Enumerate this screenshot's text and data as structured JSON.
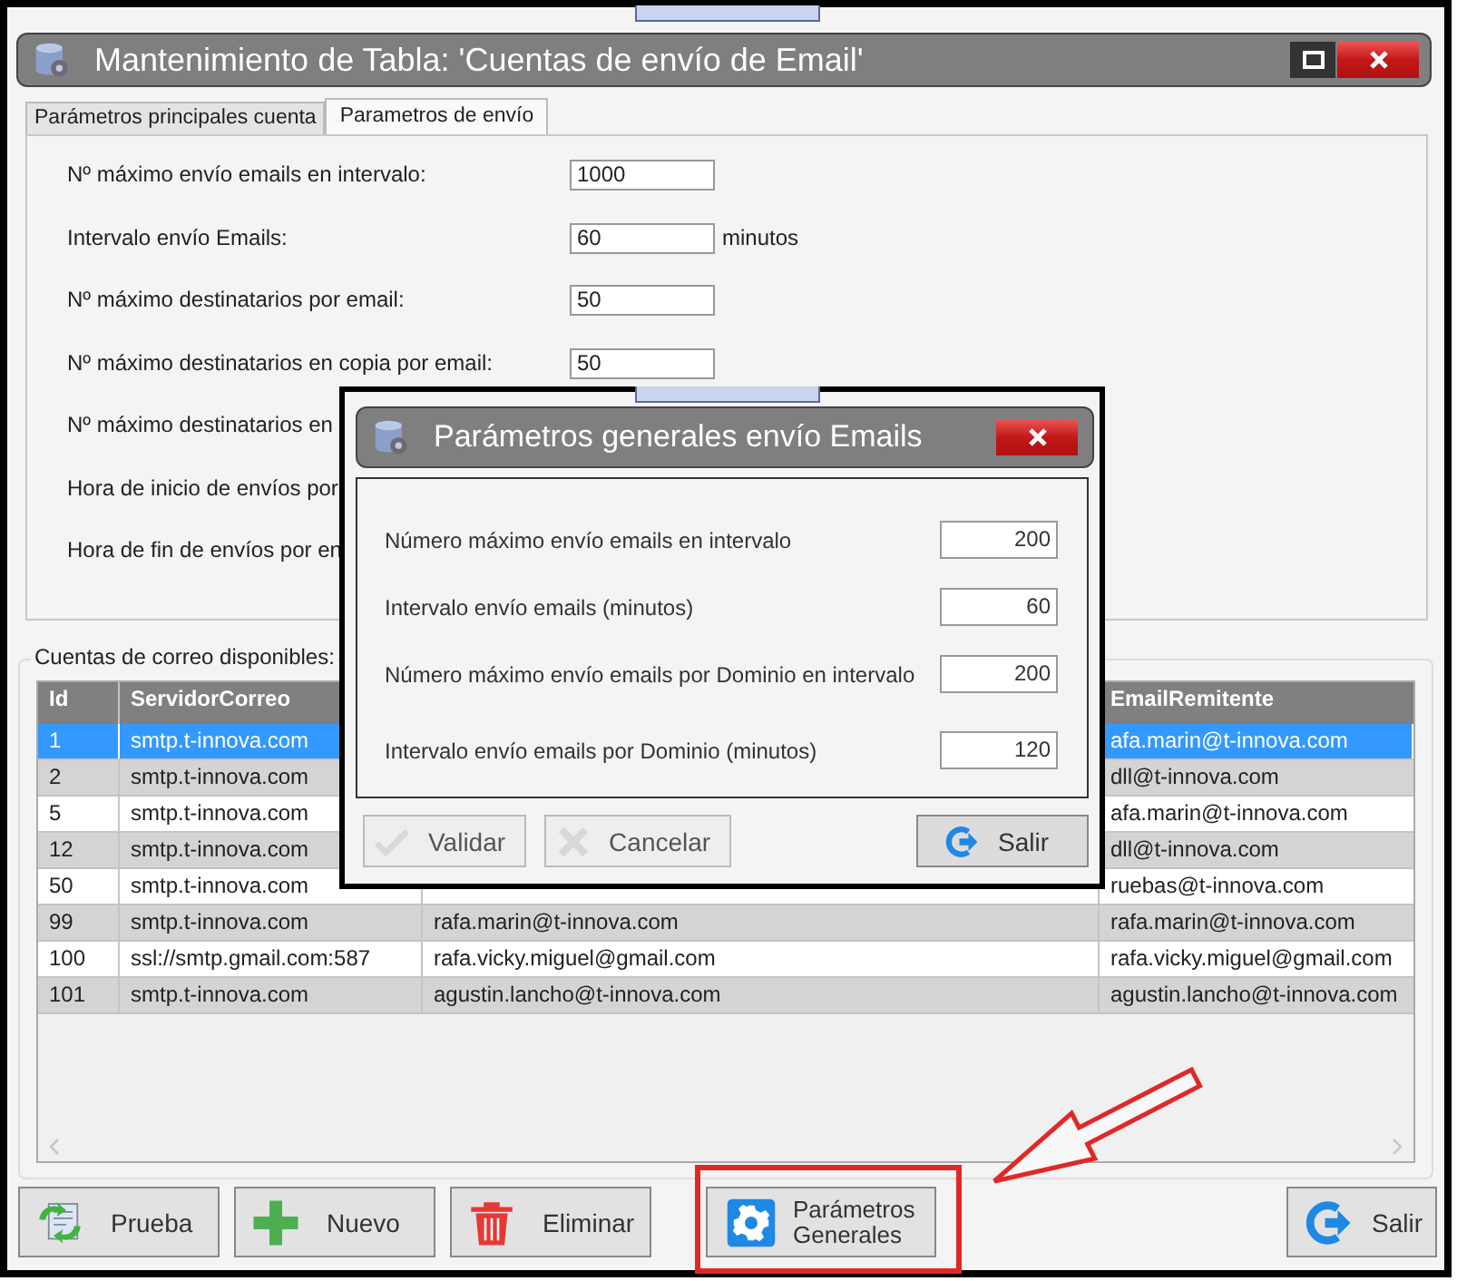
{
  "window": {
    "title": "Mantenimiento de Tabla: 'Cuentas de envío de Email'"
  },
  "tabs": [
    {
      "label": "Parámetros principales cuenta",
      "selected": false
    },
    {
      "label": "Parametros de envío",
      "selected": true
    }
  ],
  "form": {
    "fields": [
      {
        "label": "Nº máximo envío emails en intervalo:",
        "value": "1000"
      },
      {
        "label": "Intervalo envío Emails:",
        "value": "60",
        "unit": "minutos"
      },
      {
        "label": "Nº máximo destinatarios por email:",
        "value": "50"
      },
      {
        "label": "Nº máximo destinatarios en copia por email:",
        "value": "50"
      },
      {
        "label": "Nº máximo destinatarios en"
      },
      {
        "label": "Hora de inicio de envíos por"
      },
      {
        "label": "Hora de fin de envíos por en"
      }
    ]
  },
  "accounts": {
    "title": "Cuentas de correo disponibles:",
    "columns": {
      "id": "Id",
      "server": "ServidorCorreo",
      "email": "EmailRemitente"
    },
    "rows": [
      {
        "id": "1",
        "server": "smtp.t-innova.com",
        "email": "afa.marin@t-innova.com",
        "selected": true
      },
      {
        "id": "2",
        "server": "smtp.t-innova.com",
        "email": "dll@t-innova.com",
        "selected": false
      },
      {
        "id": "5",
        "server": "smtp.t-innova.com",
        "email": "afa.marin@t-innova.com",
        "selected": false
      },
      {
        "id": "12",
        "server": "smtp.t-innova.com",
        "email": "dll@t-innova.com",
        "selected": false
      },
      {
        "id": "50",
        "server": "smtp.t-innova.com",
        "email": "ruebas@t-innova.com",
        "selected": false
      },
      {
        "id": "99",
        "server": "smtp.t-innova.com",
        "column_3": "rafa.marin@t-innova.com",
        "email": "rafa.marin@t-innova.com",
        "selected": false
      },
      {
        "id": "100",
        "server": "ssl://smtp.gmail.com:587",
        "column_3": "rafa.vicky.miguel@gmail.com",
        "email": "rafa.vicky.miguel@gmail.com",
        "selected": false
      },
      {
        "id": "101",
        "server": "smtp.t-innova.com",
        "column_3": "agustin.lancho@t-innova.com",
        "email": "agustin.lancho@t-innova.com",
        "selected": false
      }
    ]
  },
  "buttons": [
    {
      "label": "Prueba",
      "kind": "test"
    },
    {
      "label": "Nuevo",
      "kind": "new"
    },
    {
      "label": "Eliminar",
      "kind": "delete"
    },
    {
      "label": "Parámetros Generales",
      "kind": "settings"
    },
    {
      "label": "Salir",
      "kind": "exit"
    }
  ],
  "dialog": {
    "title": "Parámetros generales envío Emails",
    "fields": [
      {
        "label": "Número máximo envío emails en intervalo",
        "value": "200"
      },
      {
        "label": "Intervalo envío emails (minutos)",
        "value": "60"
      },
      {
        "label": "Número máximo envío emails por Dominio en intervalo",
        "value": "200"
      },
      {
        "label": "Intervalo envío emails por Dominio (minutos)",
        "value": "120"
      }
    ],
    "buttons": [
      {
        "label": "Validar",
        "kind": "ok",
        "disabled": true
      },
      {
        "label": "Cancelar",
        "kind": "cancel",
        "disabled": true
      },
      {
        "label": "Salir",
        "kind": "exit",
        "disabled": false
      }
    ]
  }
}
